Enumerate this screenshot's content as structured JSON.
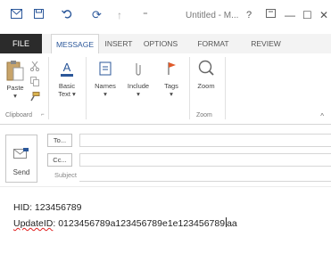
{
  "window": {
    "title": "Untitled - M...",
    "help_label": "?",
    "minimize_label": "—",
    "maximize_label": "☐",
    "close_label": "✕"
  },
  "quick_access": {
    "redo_label": "⟳",
    "customize_label": "⁼"
  },
  "ribbon": {
    "tabs": [
      {
        "label": "FILE",
        "active": false
      },
      {
        "label": "MESSAGE",
        "active": true
      },
      {
        "label": "INSERT",
        "active": false
      },
      {
        "label": "OPTIONS",
        "active": false
      },
      {
        "label": "FORMAT TEXT",
        "active": false
      },
      {
        "label": "REVIEW",
        "active": false
      }
    ],
    "clipboard": {
      "paste_label": "Paste",
      "paste_arrow": "▾",
      "group_label": "Clipboard",
      "launcher": "⌐"
    },
    "basic_text": {
      "label_line1": "Basic",
      "label_line2": "Text ▾"
    },
    "names": {
      "label": "Names",
      "arrow": "▾"
    },
    "include": {
      "label": "Include",
      "arrow": "▾"
    },
    "tags": {
      "label": "Tags",
      "arrow": "▾"
    },
    "zoom": {
      "label": "Zoom",
      "group_label": "Zoom"
    },
    "collapse_label": "^"
  },
  "compose": {
    "send_label": "Send",
    "to_label": "To...",
    "cc_label": "Cc...",
    "subject_label": "Subject",
    "to_value": "",
    "cc_value": "",
    "subject_value": ""
  },
  "body": {
    "line1": "HID: 123456789",
    "line2_key": "UpdateID",
    "line2_before_caret": ": 0123456789a123456789e1e123456789",
    "line2_after_caret": "aa"
  },
  "colors": {
    "accent": "#2b579a",
    "file_tab_bg": "#2b2b2b",
    "tab_strip_bg": "#f3f3f3",
    "spell_error": "#e02020"
  }
}
